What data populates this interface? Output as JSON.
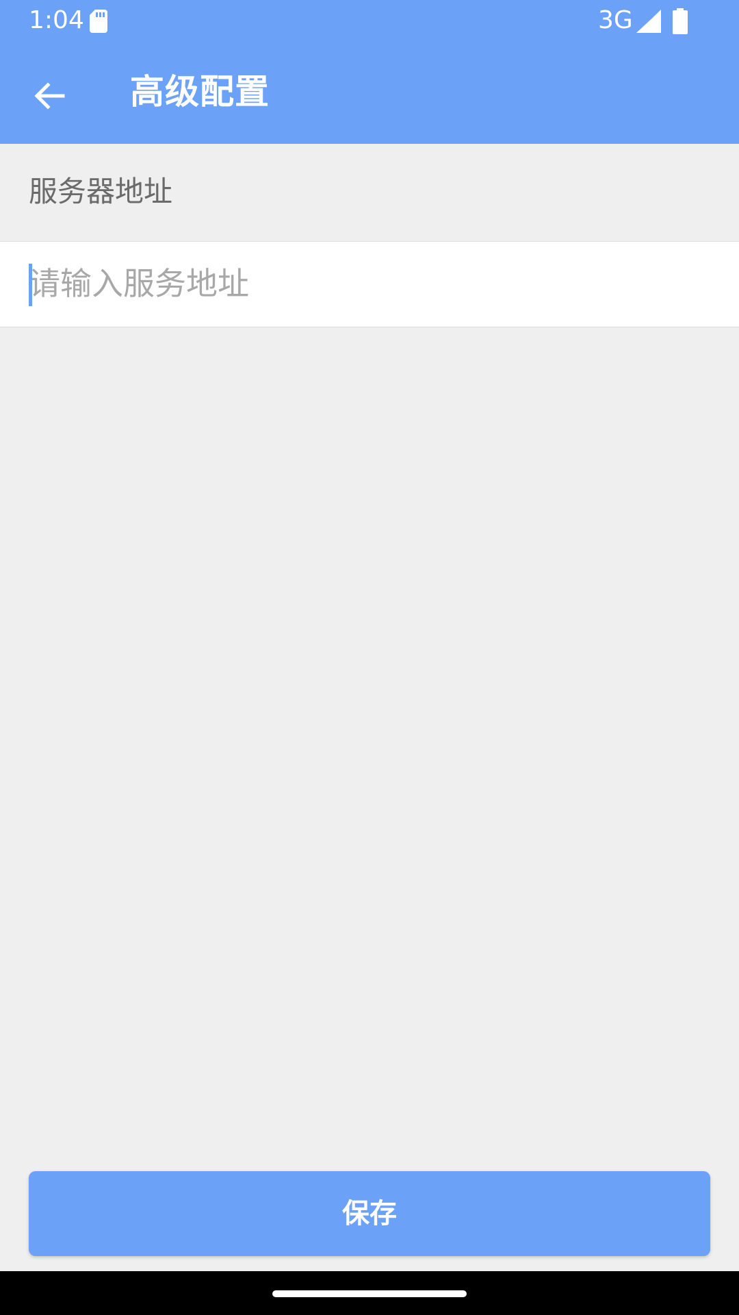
{
  "status_bar": {
    "time": "1:04",
    "network": "3G",
    "icons": [
      "sd-card-icon",
      "signal-icon",
      "battery-icon"
    ]
  },
  "toolbar": {
    "back_icon": "arrow-left-icon",
    "title": "高级配置"
  },
  "form": {
    "label": "服务器地址",
    "input_value": "",
    "input_placeholder": "请输入服务地址"
  },
  "actions": {
    "save_label": "保存"
  },
  "colors": {
    "primary": "#6ca1f8",
    "background": "#efefef",
    "input_background": "#ffffff",
    "label_text": "#6a6a6a",
    "placeholder_text": "#a8a8a8",
    "nav_bar": "#000000"
  }
}
